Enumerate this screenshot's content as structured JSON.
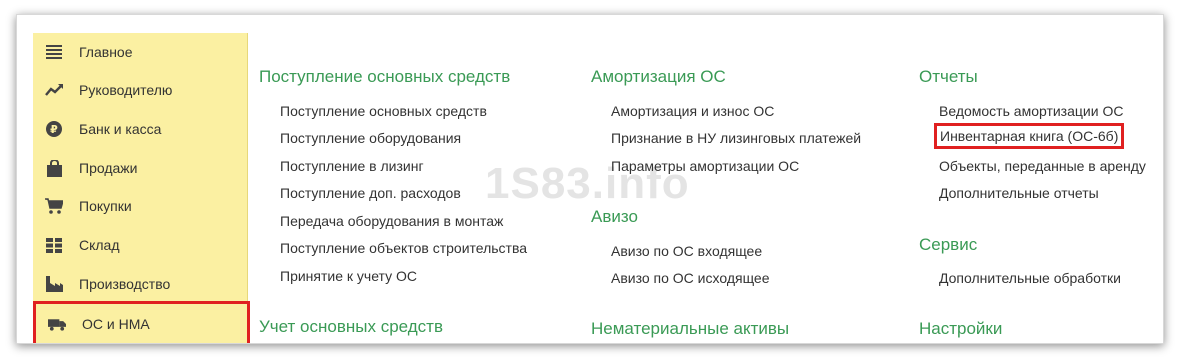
{
  "sidebar": {
    "items": [
      {
        "label": "Главное",
        "icon": "menu-icon"
      },
      {
        "label": "Руководителю",
        "icon": "trend-icon"
      },
      {
        "label": "Банк и касса",
        "icon": "ruble-coin-icon"
      },
      {
        "label": "Продажи",
        "icon": "shopping-bag-icon"
      },
      {
        "label": "Покупки",
        "icon": "shopping-cart-icon"
      },
      {
        "label": "Склад",
        "icon": "warehouse-grid-icon"
      },
      {
        "label": "Производство",
        "icon": "factory-icon"
      },
      {
        "label": "ОС и НМА",
        "icon": "truck-icon"
      }
    ]
  },
  "sections": {
    "postuplenie": {
      "title": "Поступление основных средств",
      "links": [
        "Поступление основных средств",
        "Поступление оборудования",
        "Поступление в лизинг",
        "Поступление доп. расходов",
        "Передача оборудования в монтаж",
        "Поступление объектов строительства",
        "Принятие к учету ОС"
      ]
    },
    "uchet": {
      "title": "Учет основных средств"
    },
    "amortizaciya": {
      "title": "Амортизация ОС",
      "links": [
        "Амортизация и износ ОС",
        "Признание в НУ лизинговых платежей",
        "Параметры амортизации ОС"
      ]
    },
    "avizo": {
      "title": "Авизо",
      "links": [
        "Авизо по ОС входящее",
        "Авизо по ОС исходящее"
      ]
    },
    "nma": {
      "title": "Нематериальные активы"
    },
    "otchety": {
      "title": "Отчеты",
      "links": [
        "Ведомость амортизации ОС",
        "Инвентарная книга (ОС-6б)",
        "Объекты, переданные в аренду",
        "Дополнительные отчеты"
      ]
    },
    "servis": {
      "title": "Сервис",
      "links": [
        "Дополнительные обработки"
      ]
    },
    "nastroyki": {
      "title": "Настройки"
    }
  },
  "watermark": "1S83.info",
  "colors": {
    "sidebar_bg": "#fbf0a2",
    "section_title": "#3a9a55",
    "highlight": "#e02020"
  }
}
